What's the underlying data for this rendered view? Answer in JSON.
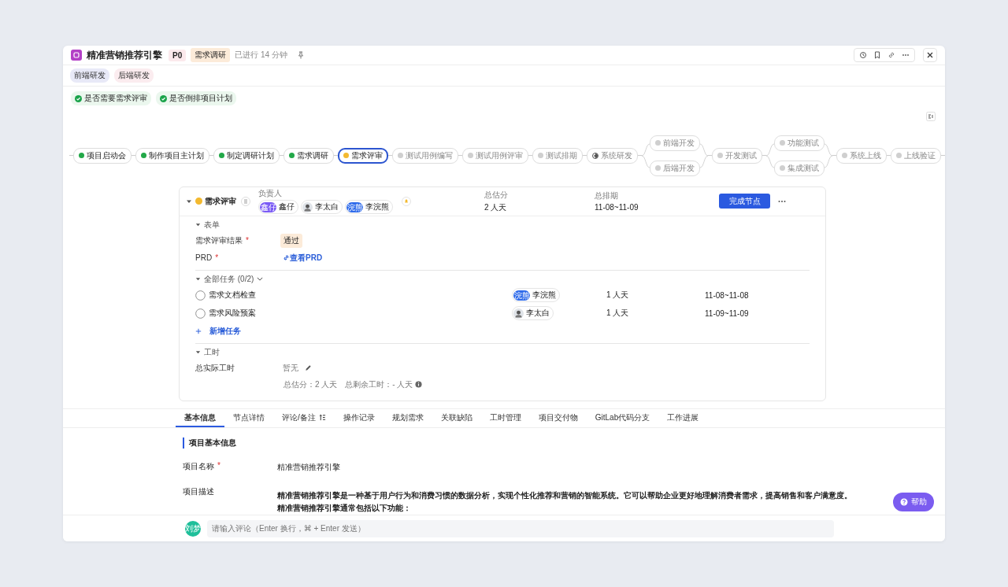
{
  "header": {
    "title": "精准营销推荐引擎",
    "priority": "P0",
    "stage": "需求调研",
    "elapsed": "已进行 14 分钟"
  },
  "tags": [
    {
      "label": "前端研发",
      "color": "#e8e9f7"
    },
    {
      "label": "后端研发",
      "color": "#fbecef"
    }
  ],
  "checks": [
    {
      "label": "是否需要需求评审",
      "checked": true
    },
    {
      "label": "是否倒排项目计划",
      "checked": true
    }
  ],
  "pipeline": [
    {
      "kind": "node",
      "label": "项目启动会",
      "done": true,
      "selected": false,
      "in_progress": false
    },
    {
      "kind": "node",
      "label": "制作项目主计划",
      "done": true,
      "selected": false,
      "in_progress": false
    },
    {
      "kind": "node",
      "label": "制定调研计划",
      "done": true,
      "selected": false,
      "in_progress": false
    },
    {
      "kind": "node",
      "label": "需求调研",
      "done": true,
      "selected": false,
      "in_progress": false
    },
    {
      "kind": "node",
      "label": "需求评审",
      "done": false,
      "selected": true,
      "in_progress": false
    },
    {
      "kind": "node",
      "label": "测试用例编写",
      "done": false,
      "selected": false,
      "in_progress": false
    },
    {
      "kind": "node",
      "label": "测试用例评审",
      "done": false,
      "selected": false,
      "in_progress": false
    },
    {
      "kind": "node",
      "label": "测试排期",
      "done": false,
      "selected": false,
      "in_progress": false
    },
    {
      "kind": "node",
      "label": "系统研发",
      "done": false,
      "selected": false,
      "in_progress": true
    },
    {
      "kind": "branch",
      "branches": [
        {
          "label": "前端开发",
          "done": false,
          "selected": false,
          "in_progress": false
        },
        {
          "label": "后端开发",
          "done": false,
          "selected": false,
          "in_progress": false
        }
      ]
    },
    {
      "kind": "node",
      "label": "开发测试",
      "done": false,
      "selected": false,
      "in_progress": false
    },
    {
      "kind": "branch",
      "branches": [
        {
          "label": "功能测试",
          "done": false,
          "selected": false,
          "in_progress": false
        },
        {
          "label": "集成测试",
          "done": false,
          "selected": false,
          "in_progress": false
        }
      ]
    },
    {
      "kind": "node",
      "label": "系统上线",
      "done": false,
      "selected": false,
      "in_progress": false
    },
    {
      "kind": "node",
      "label": "上线验证",
      "done": false,
      "selected": false,
      "in_progress": false
    }
  ],
  "node_panel": {
    "expanded": true,
    "title": "需求评审",
    "owner_label": "负责人",
    "owners": [
      {
        "name": "鑫仔",
        "kind": "initials",
        "initials": "鑫仔",
        "color": "#7a5af5"
      },
      {
        "name": "李太白",
        "kind": "photo"
      },
      {
        "name": "李浣熊",
        "kind": "initials",
        "initials": "浣熊",
        "color": "#2f6bea"
      }
    ],
    "estimate_label": "总估分",
    "estimate": "2 人天",
    "schedule_label": "总排期",
    "schedule": "11-08~11-09",
    "complete_button": "完成节点",
    "form": {
      "title": "表单",
      "expanded": true,
      "fields": [
        {
          "label": "需求评审结果",
          "required_mark": "*",
          "kind": "tag",
          "value": "通过"
        },
        {
          "label": "PRD",
          "required_mark": "*",
          "kind": "link",
          "value": "查看PRD"
        }
      ]
    },
    "tasks": {
      "title": "全部任务 (0/2)",
      "expanded": true,
      "items": [
        {
          "name": "需求文档检查",
          "checked": false,
          "assignee": {
            "name": "李浣熊",
            "kind": "initials",
            "initials": "浣熊",
            "color": "#2f6bea"
          },
          "effort": "1 人天",
          "dates": "11-08~11-08"
        },
        {
          "name": "需求风险预案",
          "checked": false,
          "assignee": {
            "name": "李太白",
            "kind": "photo"
          },
          "effort": "1 人天",
          "dates": "11-09~11-09"
        }
      ],
      "add": "新增任务"
    },
    "worktime": {
      "title": "工时",
      "expanded": true,
      "label": "总实际工时",
      "value": "暂无",
      "total": "总估分：2 人天",
      "remaining": "总剩余工时：- 人天"
    }
  },
  "tabs": [
    {
      "label": "基本信息",
      "selected": true
    },
    {
      "label": "节点详情",
      "selected": false
    },
    {
      "label": "评论/备注",
      "selected": false,
      "sort_icon": true
    },
    {
      "label": "操作记录",
      "selected": false
    },
    {
      "label": "规划需求",
      "selected": false
    },
    {
      "label": "关联缺陷",
      "selected": false
    },
    {
      "label": "工时管理",
      "selected": false
    },
    {
      "label": "项目交付物",
      "selected": false
    },
    {
      "label": "GitLab代码分支",
      "selected": false
    },
    {
      "label": "工作进展",
      "selected": false
    }
  ],
  "basic_info": {
    "title": "项目基本信息",
    "fields": [
      {
        "label": "项目名称",
        "required_mark": "*",
        "kind": "plain",
        "lines": [
          "精准营销推荐引擎"
        ]
      },
      {
        "label": "项目描述",
        "kind": "bold",
        "lines": [
          "精准营销推荐引擎是一种基于用户行为和消费习惯的数据分析，实现个性化推荐和营销的智能系统。它可以帮助企业更好地理解消费者需求，提高销售和客户满意度。",
          "精准营销推荐引擎通常包括以下功能："
        ]
      }
    ]
  },
  "comment": {
    "avatar": "刘梦",
    "placeholder": "请输入评论（Enter 换行，⌘ + Enter 发送）"
  },
  "help": "帮助"
}
